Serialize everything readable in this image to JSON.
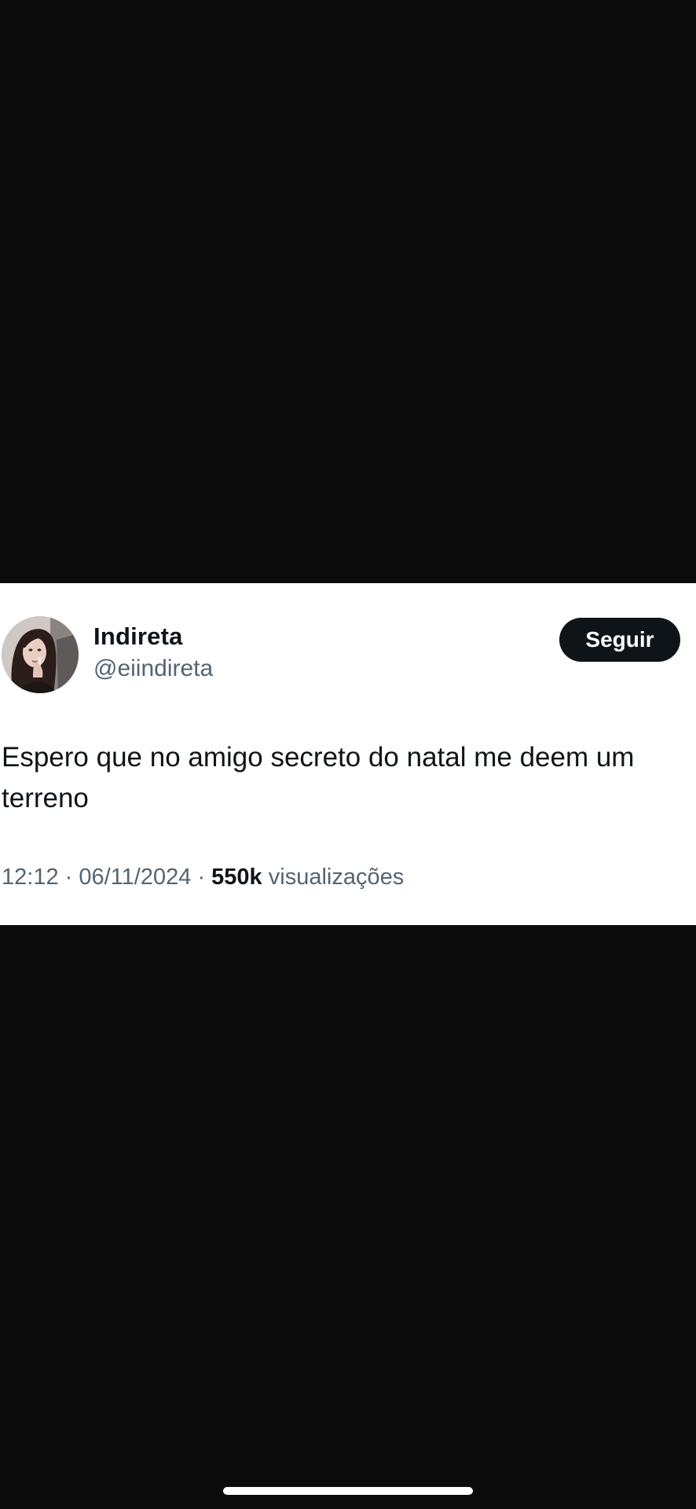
{
  "tweet": {
    "author": {
      "display_name": "Indireta",
      "handle": "@eiindireta",
      "avatar_icon": "profile-photo"
    },
    "follow_label": "Seguir",
    "text": "Espero que no amigo secreto do natal me deem um terreno",
    "time": "12:12",
    "separator": "·",
    "date": "06/11/2024",
    "views_count": "550k",
    "views_label": "visualizações"
  },
  "colors": {
    "background": "#0b0b0c",
    "card": "#ffffff",
    "primary_text": "#0f1419",
    "secondary_text": "#536471",
    "follow_button": "#0f1419"
  }
}
